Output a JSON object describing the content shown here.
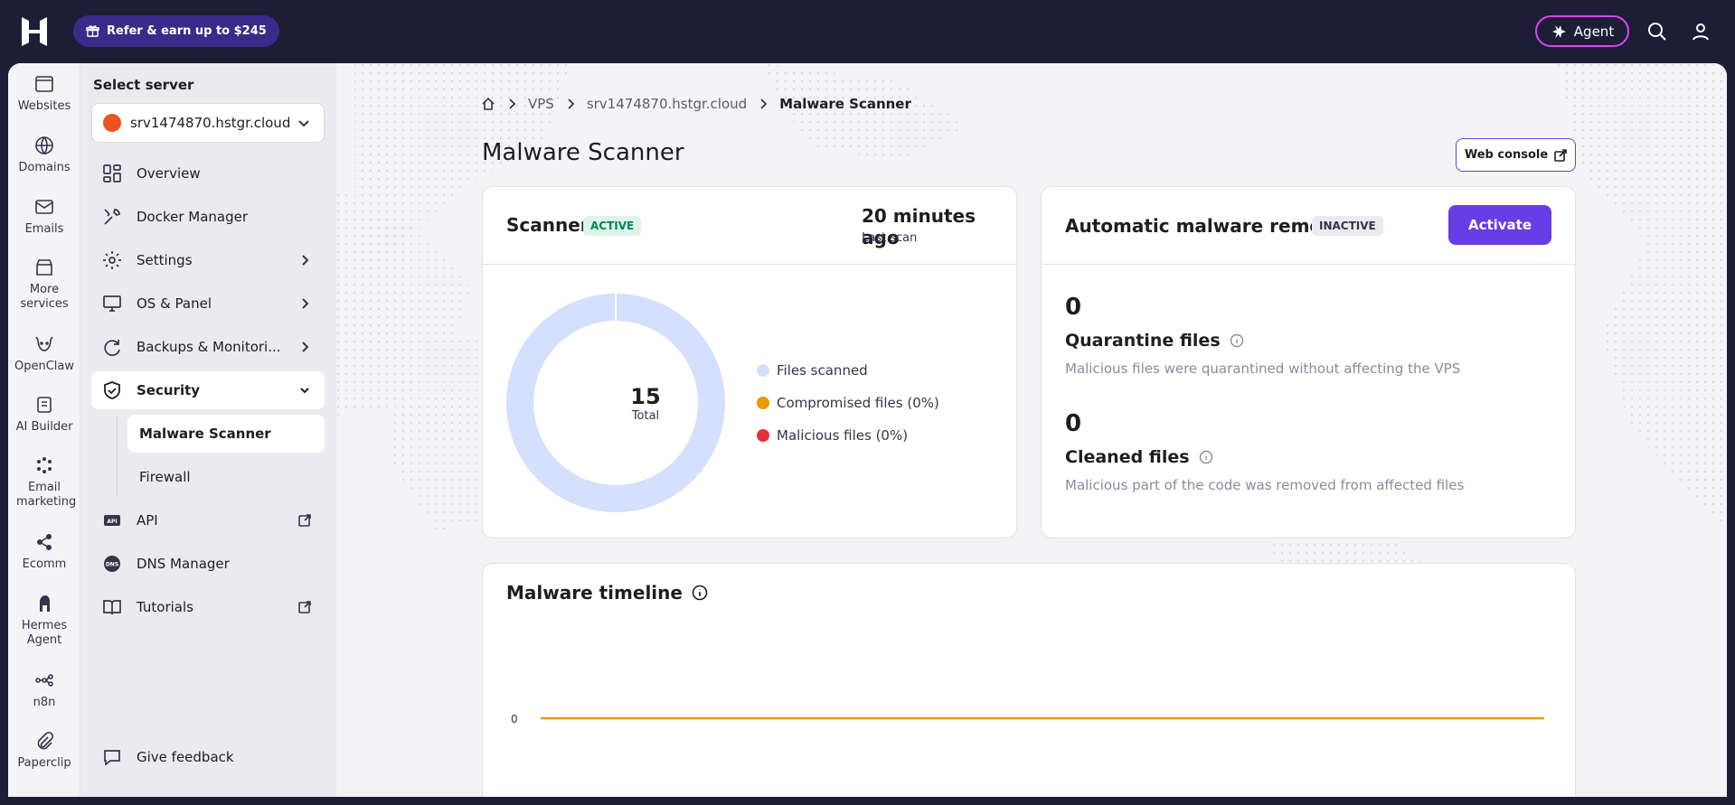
{
  "topbar": {
    "refer_label": "Refer & earn up to $245",
    "agent_label": "Agent"
  },
  "rail": [
    {
      "label": "Websites",
      "icon": "browser-icon"
    },
    {
      "label": "Domains",
      "icon": "globe-icon"
    },
    {
      "label": "Emails",
      "icon": "mail-icon"
    },
    {
      "label": "More services",
      "icon": "store-icon"
    },
    {
      "label": "OpenClaw",
      "icon": "openclaw-icon"
    },
    {
      "label": "AI Builder",
      "icon": "ai-builder-icon"
    },
    {
      "label": "Email marketing",
      "icon": "email-marketing-icon"
    },
    {
      "label": "Ecomm",
      "icon": "share-icon"
    },
    {
      "label": "Hermes Agent",
      "icon": "hermes-icon"
    },
    {
      "label": "n8n",
      "icon": "n8n-icon"
    },
    {
      "label": "Paperclip",
      "icon": "paperclip-icon"
    }
  ],
  "sidebar": {
    "select_label": "Select server",
    "server": "srv1474870.hstgr.cloud",
    "items": [
      {
        "label": "Overview",
        "icon": "grid-icon"
      },
      {
        "label": "Docker Manager",
        "icon": "tools-icon"
      },
      {
        "label": "Settings",
        "icon": "gear-icon"
      },
      {
        "label": "OS & Panel",
        "icon": "monitor-icon"
      },
      {
        "label": "Backups & Monitori...",
        "icon": "refresh-icon"
      },
      {
        "label": "Security",
        "icon": "shield-icon"
      },
      {
        "label": "API",
        "icon": "api-icon"
      },
      {
        "label": "DNS Manager",
        "icon": "dns-icon"
      },
      {
        "label": "Tutorials",
        "icon": "book-icon"
      }
    ],
    "security_sub": [
      "Malware Scanner",
      "Firewall"
    ],
    "feedback": "Give feedback"
  },
  "breadcrumb": [
    "VPS",
    "srv1474870.hstgr.cloud",
    "Malware Scanner"
  ],
  "page_title": "Malware Scanner",
  "web_console": "Web console",
  "scanner": {
    "title": "Scanner",
    "status": "ACTIVE",
    "last_scan_value": "20 minutes ago",
    "last_scan_label": "Last scan",
    "total_value": "15",
    "total_label": "Total",
    "legend": [
      {
        "label": "Files scanned",
        "color": "#d5dffe"
      },
      {
        "label": "Compromised files (0%)",
        "color": "#ea9a00"
      },
      {
        "label": "Malicious files (0%)",
        "color": "#e5303d"
      }
    ],
    "files_scanned": 15,
    "compromised_files": 0,
    "malicious_files": 0
  },
  "removal": {
    "title": "Automatic malware removal",
    "status": "INACTIVE",
    "activate_label": "Activate",
    "quarantine_count": "0",
    "quarantine_title": "Quarantine files",
    "quarantine_desc": "Malicious files were quarantined without affecting the VPS",
    "cleaned_count": "0",
    "cleaned_title": "Cleaned files",
    "cleaned_desc": "Malicious part of the code was removed from affected files"
  },
  "timeline": {
    "title": "Malware timeline",
    "y_tick": "0"
  },
  "colors": {
    "primary": "#673de6",
    "topbar": "#1d1e36",
    "agent_border": "#d946ef",
    "timeline_line": "#ea9a00"
  }
}
